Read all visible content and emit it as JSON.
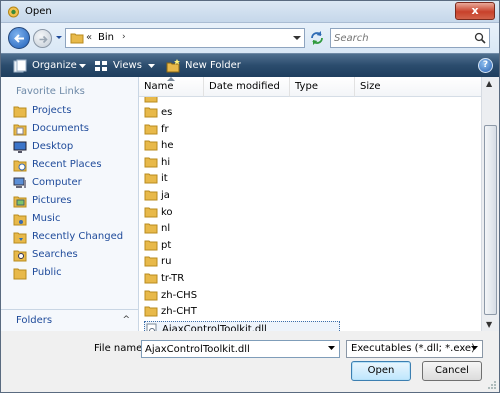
{
  "window": {
    "title": "Open",
    "close_label": "x"
  },
  "address_bar": {
    "chevron": "«",
    "path": "Bin",
    "path_arrow": "›"
  },
  "search": {
    "placeholder": "Search"
  },
  "toolbar": {
    "organize": "Organize",
    "views": "Views",
    "new_folder": "New Folder",
    "help": "?"
  },
  "favorites": {
    "title": "Favorite Links",
    "items": [
      {
        "label": "Projects",
        "icon": "folder-icon"
      },
      {
        "label": "Documents",
        "icon": "documents-icon"
      },
      {
        "label": "Desktop",
        "icon": "desktop-icon"
      },
      {
        "label": "Recent Places",
        "icon": "recent-places-icon"
      },
      {
        "label": "Computer",
        "icon": "computer-icon"
      },
      {
        "label": "Pictures",
        "icon": "pictures-icon"
      },
      {
        "label": "Music",
        "icon": "music-icon"
      },
      {
        "label": "Recently Changed",
        "icon": "recently-changed-icon"
      },
      {
        "label": "Searches",
        "icon": "searches-icon"
      },
      {
        "label": "Public",
        "icon": "public-icon"
      }
    ],
    "folders_label": "Folders",
    "folders_arrow": "^"
  },
  "columns": [
    "Name",
    "Date modified",
    "Type",
    "Size"
  ],
  "files": [
    {
      "name": "es",
      "type": "folder"
    },
    {
      "name": "fr",
      "type": "folder"
    },
    {
      "name": "he",
      "type": "folder"
    },
    {
      "name": "hi",
      "type": "folder"
    },
    {
      "name": "it",
      "type": "folder"
    },
    {
      "name": "ja",
      "type": "folder"
    },
    {
      "name": "ko",
      "type": "folder"
    },
    {
      "name": "nl",
      "type": "folder"
    },
    {
      "name": "pt",
      "type": "folder"
    },
    {
      "name": "ru",
      "type": "folder"
    },
    {
      "name": "tr-TR",
      "type": "folder"
    },
    {
      "name": "zh-CHS",
      "type": "folder"
    },
    {
      "name": "zh-CHT",
      "type": "folder"
    },
    {
      "name": "AjaxControlToolkit.dll",
      "type": "dll"
    }
  ],
  "file_name": {
    "label": "File name:",
    "value": "AjaxControlToolkit.dll"
  },
  "file_type": {
    "value": "Executables (*.dll; *.exe)"
  },
  "buttons": {
    "open": "Open",
    "cancel": "Cancel"
  },
  "colors": {
    "toolbar": "#2b4c6d",
    "link": "#1e4a9a",
    "folder": "#e8b94a"
  }
}
